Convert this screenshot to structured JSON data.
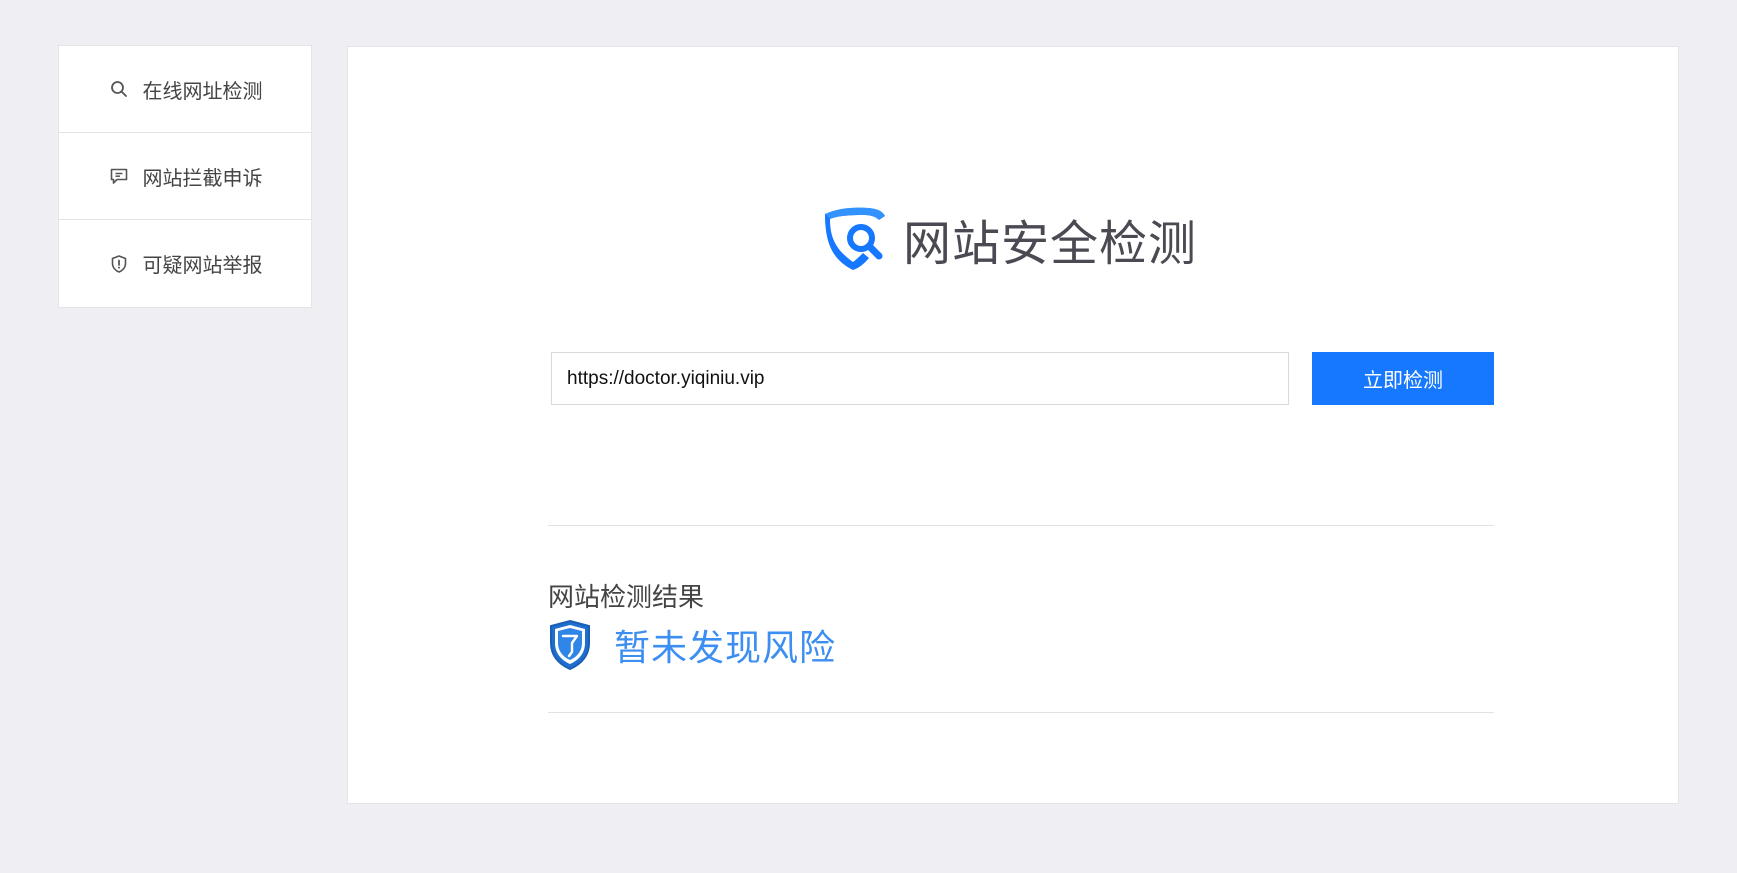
{
  "sidebar": {
    "items": [
      {
        "label": "在线网址检测",
        "icon": "search-icon"
      },
      {
        "label": "网站拦截申诉",
        "icon": "comment-icon"
      },
      {
        "label": "可疑网站举报",
        "icon": "shield-alert-icon"
      }
    ]
  },
  "header": {
    "title": "网站安全检测",
    "logo_icon": "shield-search-logo-icon"
  },
  "search": {
    "value": "https://doctor.yiqiniu.vip",
    "button_label": "立即检测"
  },
  "result": {
    "heading": "网站检测结果",
    "status": "暂未发现风险",
    "status_icon": "shield-check-icon"
  },
  "colors": {
    "accent": "#1677ff",
    "status": "#3c8ef0",
    "background": "#efeff3"
  }
}
